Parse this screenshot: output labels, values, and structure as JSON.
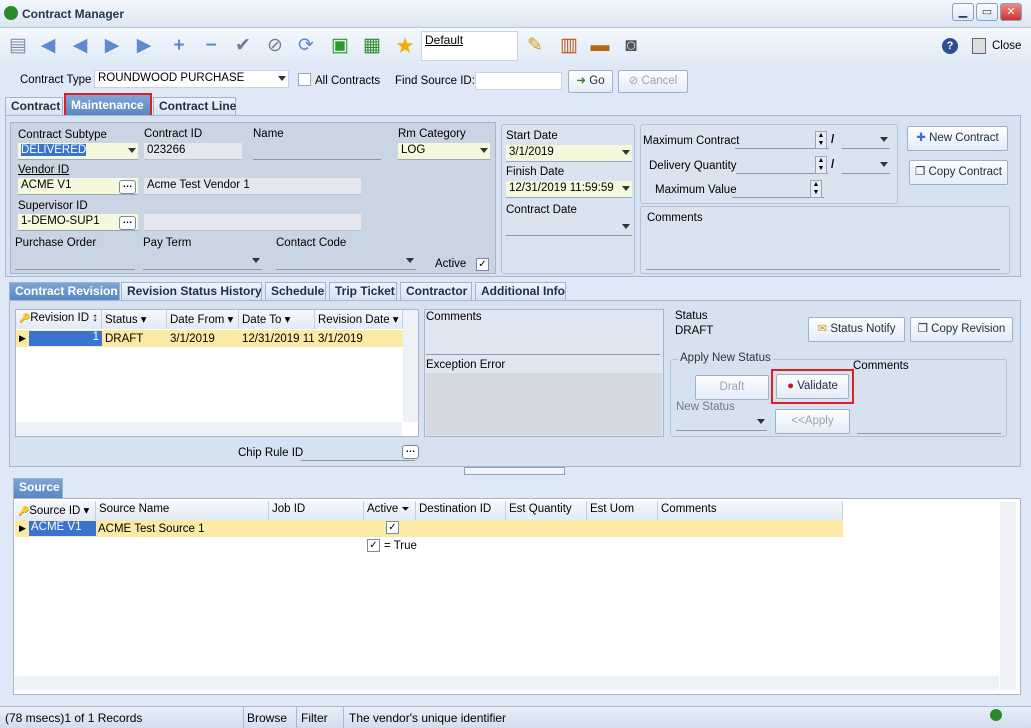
{
  "window": {
    "title": "Contract Manager",
    "close_label": "Close"
  },
  "toolbar": {
    "layout_name": "Default"
  },
  "filter": {
    "contract_type_label": "Contract Type",
    "contract_type_value": "ROUNDWOOD PURCHASE",
    "all_contracts_label": "All Contracts",
    "find_source_label": "Find Source ID:",
    "go_label": "Go",
    "cancel_label": "Cancel"
  },
  "main_tabs": [
    "Contract",
    "Maintenance",
    "Contract Line"
  ],
  "contract": {
    "subtype_label": "Contract Subtype",
    "subtype_value": "DELIVERED",
    "contract_id_label": "Contract ID",
    "contract_id_value": "023266",
    "name_label": "Name",
    "rm_category_label": "Rm Category",
    "rm_category_value": "LOG",
    "vendor_id_label": "Vendor ID",
    "vendor_id_value": "ACME V1",
    "vendor_name": "Acme Test Vendor 1",
    "supervisor_id_label": "Supervisor ID",
    "supervisor_id_value": "1-DEMO-SUP1",
    "purchase_order_label": "Purchase Order",
    "pay_term_label": "Pay Term",
    "contact_code_label": "Contact Code",
    "active_label": "Active"
  },
  "dates": {
    "start_label": "Start Date",
    "start_value": "3/1/2019",
    "finish_label": "Finish Date",
    "finish_value": "12/31/2019 11:59:59",
    "contract_date_label": "Contract Date"
  },
  "limits": {
    "max_contract_label": "Maximum Contract",
    "delivery_qty_label": "Delivery Quantity",
    "max_value_label": "Maximum Value",
    "slash": "/",
    "comments_label": "Comments"
  },
  "actions": {
    "new_contract": "New Contract",
    "copy_contract": "Copy Contract"
  },
  "rev_tabs": [
    "Contract Revision",
    "Revision Status History",
    "Schedule",
    "Trip Ticket",
    "Contractor",
    "Additional Info"
  ],
  "revision_grid": {
    "headers": [
      "Revision ID",
      "Status",
      "Date From",
      "Date To",
      "Revision Date"
    ],
    "rows": [
      [
        "1",
        "DRAFT",
        "3/1/2019",
        "12/31/2019 11:",
        "3/1/2019"
      ]
    ]
  },
  "revision": {
    "comments_label": "Comments",
    "exception_label": "Exception Error",
    "status_label": "Status",
    "status_value": "DRAFT",
    "status_notify": "Status Notify",
    "copy_revision": "Copy Revision",
    "apply_group": "Apply New Status",
    "draft_btn": "Draft",
    "validate_btn": "Validate",
    "new_status_label": "New Status",
    "apply_btn": "<<Apply",
    "comments2_label": "Comments",
    "chip_rule_label": "Chip Rule ID"
  },
  "source": {
    "tab": "Source",
    "headers": [
      "Source ID",
      "Source Name",
      "Job ID",
      "Active",
      "Destination ID",
      "Est Quantity",
      "Est Uom",
      "Comments"
    ],
    "rows": [
      [
        "ACME V1",
        "ACME Test Source 1",
        "",
        "✓",
        "",
        "",
        "",
        ""
      ]
    ],
    "filter_text": "= True"
  },
  "statusbar": {
    "records": "(78 msecs)1 of 1 Records",
    "browse": "Browse",
    "filter": "Filter",
    "hint": "The vendor's unique identifier"
  }
}
